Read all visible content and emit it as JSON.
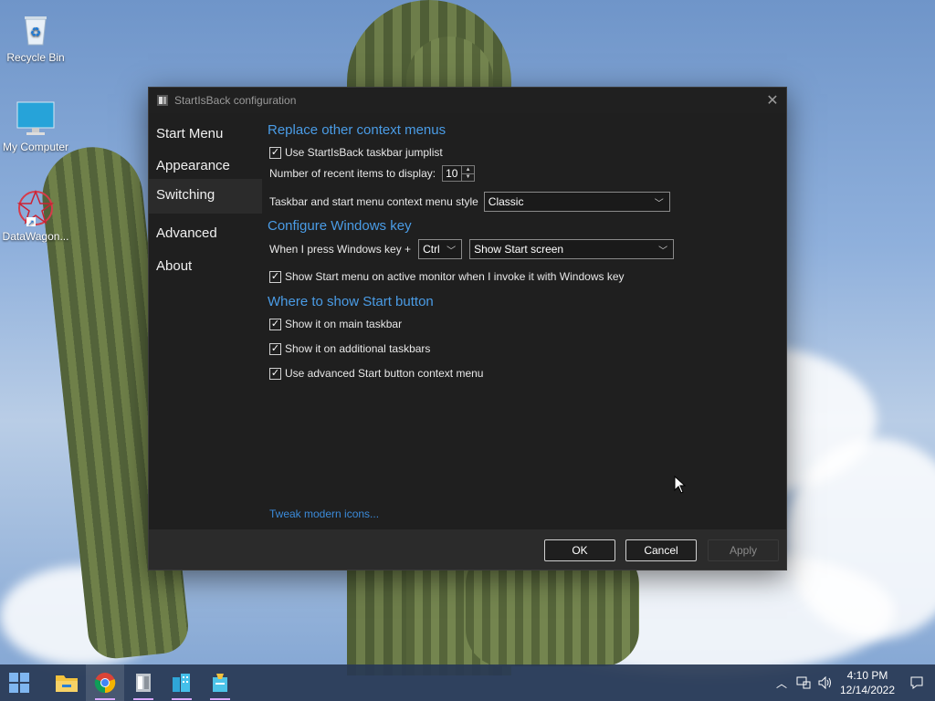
{
  "desktop": {
    "icons": [
      {
        "label": "Recycle Bin"
      },
      {
        "label": "My Computer"
      },
      {
        "label": "DataWagon..."
      }
    ]
  },
  "window": {
    "title": "StartIsBack configuration",
    "close_glyph": "✕",
    "nav": [
      "Start Menu",
      "Appearance",
      "Switching",
      "Advanced",
      "About"
    ],
    "active_nav": "Switching",
    "sections": {
      "context": {
        "title": "Replace other context menus",
        "jumplist_label": "Use StartIsBack taskbar jumplist",
        "jumplist_checked": true,
        "recent_label": "Number of recent items to display:",
        "recent_value": "10",
        "style_label": "Taskbar and start menu context menu style",
        "style_value": "Classic"
      },
      "winkey": {
        "title": "Configure Windows key",
        "press_label": "When I press Windows key +",
        "modifier_value": "Ctrl",
        "action_value": "Show Start screen",
        "monitor_label": "Show Start menu on active monitor when I invoke it with Windows key",
        "monitor_checked": true
      },
      "startbutton": {
        "title": "Where to show Start button",
        "main_label": "Show it on main taskbar",
        "main_checked": true,
        "additional_label": "Show it on additional taskbars",
        "additional_checked": true,
        "advanced_label": "Use advanced Start button context menu",
        "advanced_checked": true
      }
    },
    "tweak_link": "Tweak modern icons...",
    "buttons": {
      "ok": "OK",
      "cancel": "Cancel",
      "apply": "Apply"
    }
  },
  "taskbar": {
    "clock_time": "4:10 PM",
    "clock_date": "12/14/2022"
  },
  "colors": {
    "accent": "#4a9ce6",
    "window_bg": "#1f1f1f",
    "footer_bg": "#2b2b2b",
    "taskbar_bg": "#283854"
  }
}
